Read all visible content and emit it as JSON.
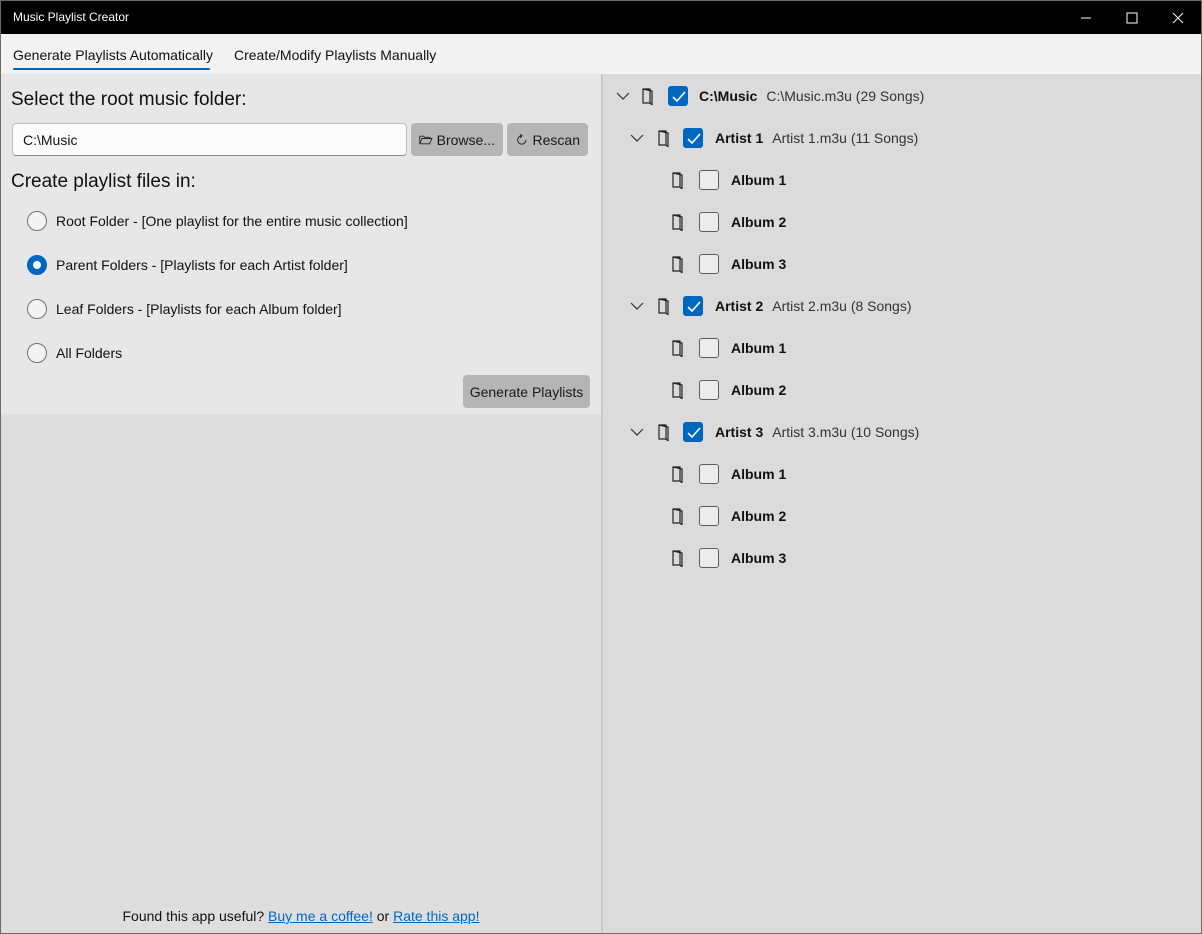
{
  "window": {
    "title": "Music Playlist Creator"
  },
  "tabs": [
    {
      "label": "Generate Playlists Automatically",
      "active": true
    },
    {
      "label": "Create/Modify Playlists Manually",
      "active": false
    }
  ],
  "left": {
    "root_heading": "Select the root music folder:",
    "folder_value": "C:\\Music",
    "browse_label": "Browse...",
    "rescan_label": "Rescan",
    "create_heading": "Create playlist files in:",
    "options": [
      {
        "label": "Root Folder - [One playlist for the entire music collection]",
        "selected": false
      },
      {
        "label": "Parent Folders - [Playlists for each Artist folder]",
        "selected": true
      },
      {
        "label": "Leaf Folders - [Playlists for each Album folder]",
        "selected": false
      },
      {
        "label": "All Folders",
        "selected": false
      }
    ],
    "generate_label": "Generate Playlists"
  },
  "footer": {
    "text": "Found this app useful?",
    "coffee_link": "Buy me a coffee!",
    "or": "or",
    "rate_link": "Rate this app!"
  },
  "tree": {
    "root": {
      "name": "C:\\Music",
      "file": "C:\\Music.m3u (29 Songs)",
      "checked": true
    },
    "artists": [
      {
        "name": "Artist 1",
        "file": "Artist 1.m3u (11 Songs)",
        "checked": true,
        "albums": [
          {
            "name": "Album 1",
            "checked": false
          },
          {
            "name": "Album 2",
            "checked": false
          },
          {
            "name": "Album 3",
            "checked": false
          }
        ]
      },
      {
        "name": "Artist 2",
        "file": "Artist 2.m3u (8 Songs)",
        "checked": true,
        "albums": [
          {
            "name": "Album 1",
            "checked": false
          },
          {
            "name": "Album 2",
            "checked": false
          }
        ]
      },
      {
        "name": "Artist 3",
        "file": "Artist 3.m3u (10 Songs)",
        "checked": true,
        "albums": [
          {
            "name": "Album 1",
            "checked": false
          },
          {
            "name": "Album 2",
            "checked": false
          },
          {
            "name": "Album 3",
            "checked": false
          }
        ]
      }
    ]
  },
  "colors": {
    "accent": "#0067c0",
    "titlebar": "#000000"
  }
}
